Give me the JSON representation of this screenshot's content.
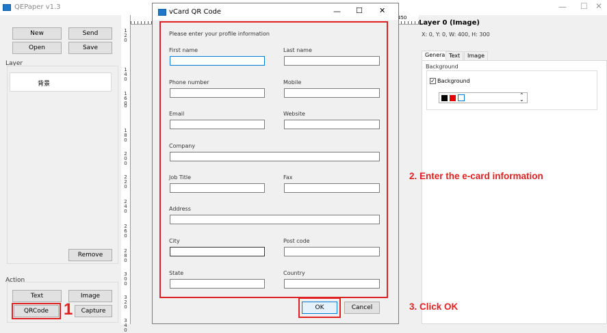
{
  "main_window": {
    "title": "QEPaper v1.3"
  },
  "left_panel": {
    "buttons": {
      "new": "New",
      "send": "Send",
      "open": "Open",
      "save": "Save",
      "remove": "Remove",
      "text": "Text",
      "image": "Image",
      "qrcode": "QRCode",
      "capture": "Capture"
    },
    "layer_label": "Layer",
    "layer_items": [
      "背景"
    ],
    "action_label": "Action"
  },
  "ruler": {
    "top_label": "450",
    "side_labels": [
      "120",
      "140",
      "160",
      "0",
      "180",
      "200",
      "220",
      "240",
      "260",
      "280",
      "300",
      "320",
      "340"
    ]
  },
  "right_panel": {
    "layer_title": "Layer 0 (Image)",
    "layer_info": "X: 0, Y: 0, W: 400, H: 300",
    "tabs": [
      "General",
      "Text",
      "Image"
    ],
    "background_group": "Background",
    "background_checkbox": "Background",
    "colors": {
      "black": "#000000",
      "red": "#e00000",
      "white": "#ffffff"
    }
  },
  "dialog": {
    "title": "vCard QR Code",
    "prompt": "Please enter your profile information",
    "fields": {
      "first_name": "First name",
      "last_name": "Last name",
      "phone": "Phone number",
      "mobile": "Mobile",
      "email": "Email",
      "website": "Website",
      "company": "Company",
      "job_title": "Job Title",
      "fax": "Fax",
      "address": "Address",
      "city": "City",
      "post_code": "Post code",
      "state": "State",
      "country": "Country"
    },
    "ok": "OK",
    "cancel": "Cancel"
  },
  "annotations": {
    "step1": "1",
    "step2": "2. Enter the e-card information",
    "step3": "3. Click OK",
    "color": "#e02020"
  }
}
